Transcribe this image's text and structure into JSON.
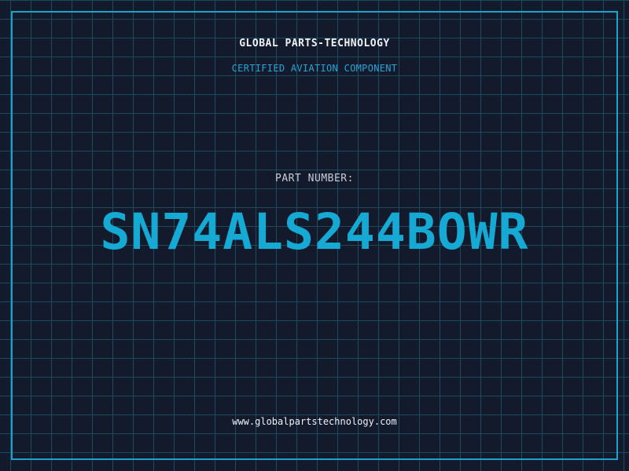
{
  "header": {
    "company": "GLOBAL PARTS-TECHNOLOGY",
    "subtitle": "CERTIFIED AVIATION COMPONENT"
  },
  "part": {
    "label": "PART NUMBER:",
    "number": "SN74ALS244BOWR"
  },
  "footer": {
    "website": "www.globalpartstechnology.com"
  },
  "colors": {
    "background": "#121a2c",
    "grid": "#1d4a5e",
    "accent": "#15a9d4",
    "text": "#eef2f6"
  }
}
